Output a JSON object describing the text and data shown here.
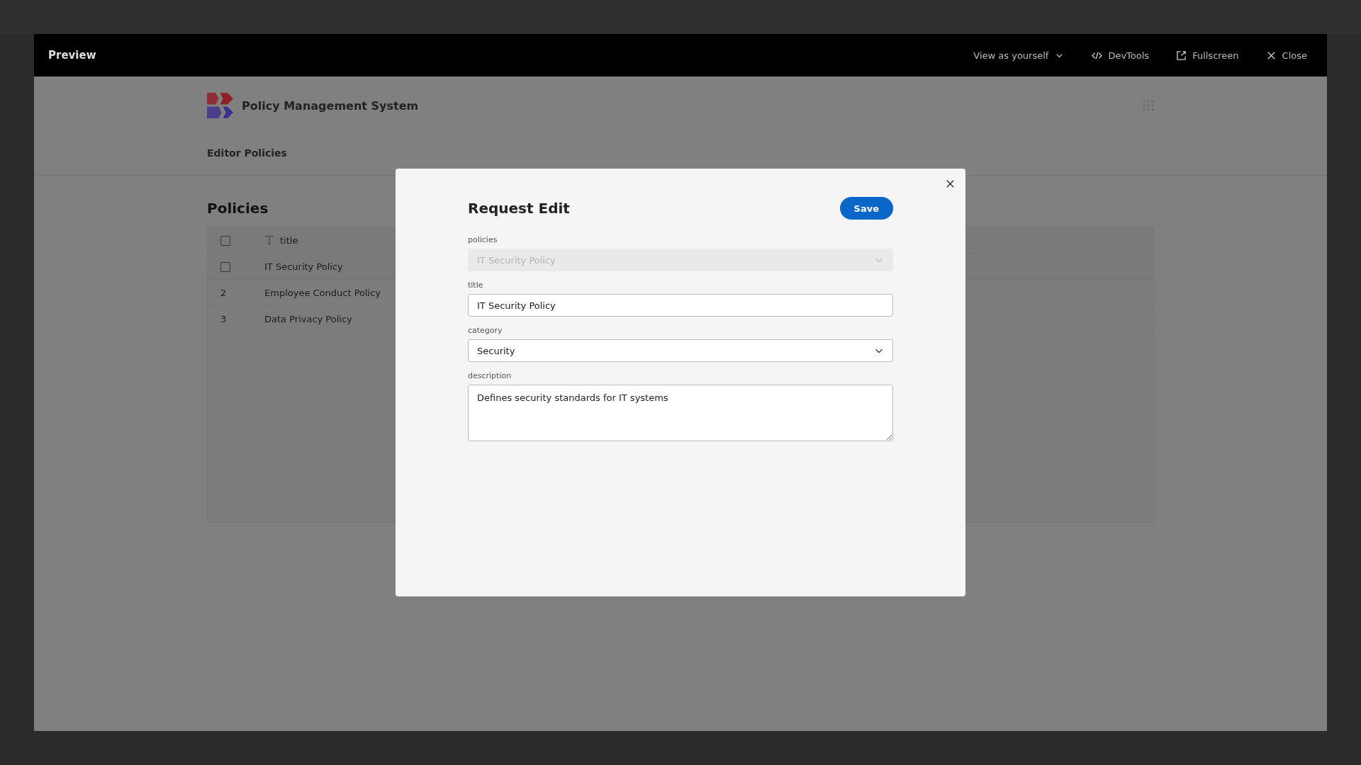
{
  "preview_bar": {
    "title": "Preview",
    "actions": [
      {
        "kind": "view",
        "label": "View as yourself"
      },
      {
        "kind": "devtools",
        "label": "DevTools"
      },
      {
        "kind": "fullscreen",
        "label": "Fullscreen"
      },
      {
        "kind": "close",
        "label": "Close"
      }
    ]
  },
  "app": {
    "title": "Policy Management System",
    "page_title": "Editor Policies"
  },
  "table": {
    "title": "Policies",
    "header": {
      "checked": false,
      "label": "title"
    },
    "rows": [
      {
        "kind": "checkbox",
        "checked": false,
        "title": "IT Security Policy"
      },
      {
        "kind": "number",
        "number": "2",
        "title": "Employee Conduct Policy"
      },
      {
        "kind": "number",
        "number": "3",
        "title": "Data Privacy Policy"
      }
    ]
  },
  "modal": {
    "title": "Request Edit",
    "save": "Save",
    "fields": [
      {
        "kind": "select",
        "label": "policies",
        "value": "IT Security Policy",
        "disabled": true
      },
      {
        "kind": "text",
        "label": "title",
        "value": "IT Security Policy",
        "disabled": false
      },
      {
        "kind": "select",
        "label": "category",
        "value": "Security",
        "disabled": false
      },
      {
        "kind": "textarea",
        "label": "description",
        "value": "Defines security standards for IT systems",
        "disabled": false
      }
    ]
  }
}
